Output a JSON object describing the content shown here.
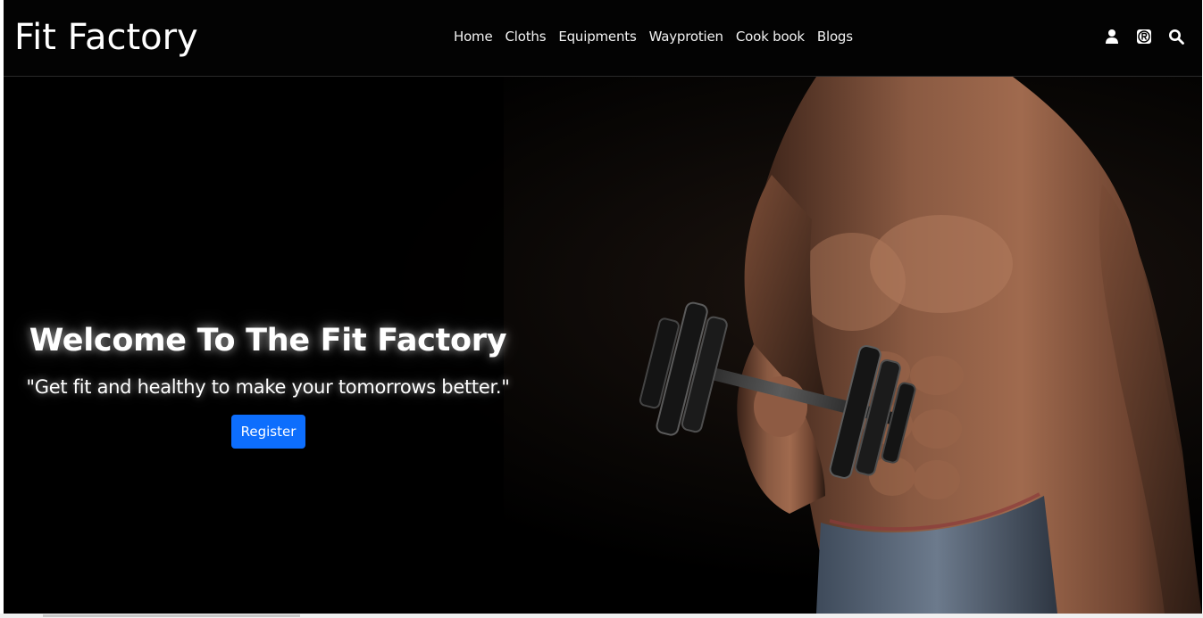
{
  "navbar": {
    "brand": "Fit Factory",
    "links": [
      {
        "label": "Home"
      },
      {
        "label": "Cloths"
      },
      {
        "label": "Equipments"
      },
      {
        "label": "Wayprotien"
      },
      {
        "label": "Cook book"
      },
      {
        "label": "Blogs"
      }
    ],
    "icons": [
      "user-icon",
      "registered-icon",
      "search-icon"
    ]
  },
  "hero": {
    "title": "Welcome To The Fit Factory",
    "tagline": "\"Get fit and healthy to make your tomorrows better.\"",
    "register_label": "Register",
    "image": "shirtless-man-lifting-dumbbell"
  },
  "colors": {
    "navbar_bg": "#030303",
    "hero_bg": "#000000",
    "accent": "#0d6efd",
    "text": "#ffffff"
  }
}
